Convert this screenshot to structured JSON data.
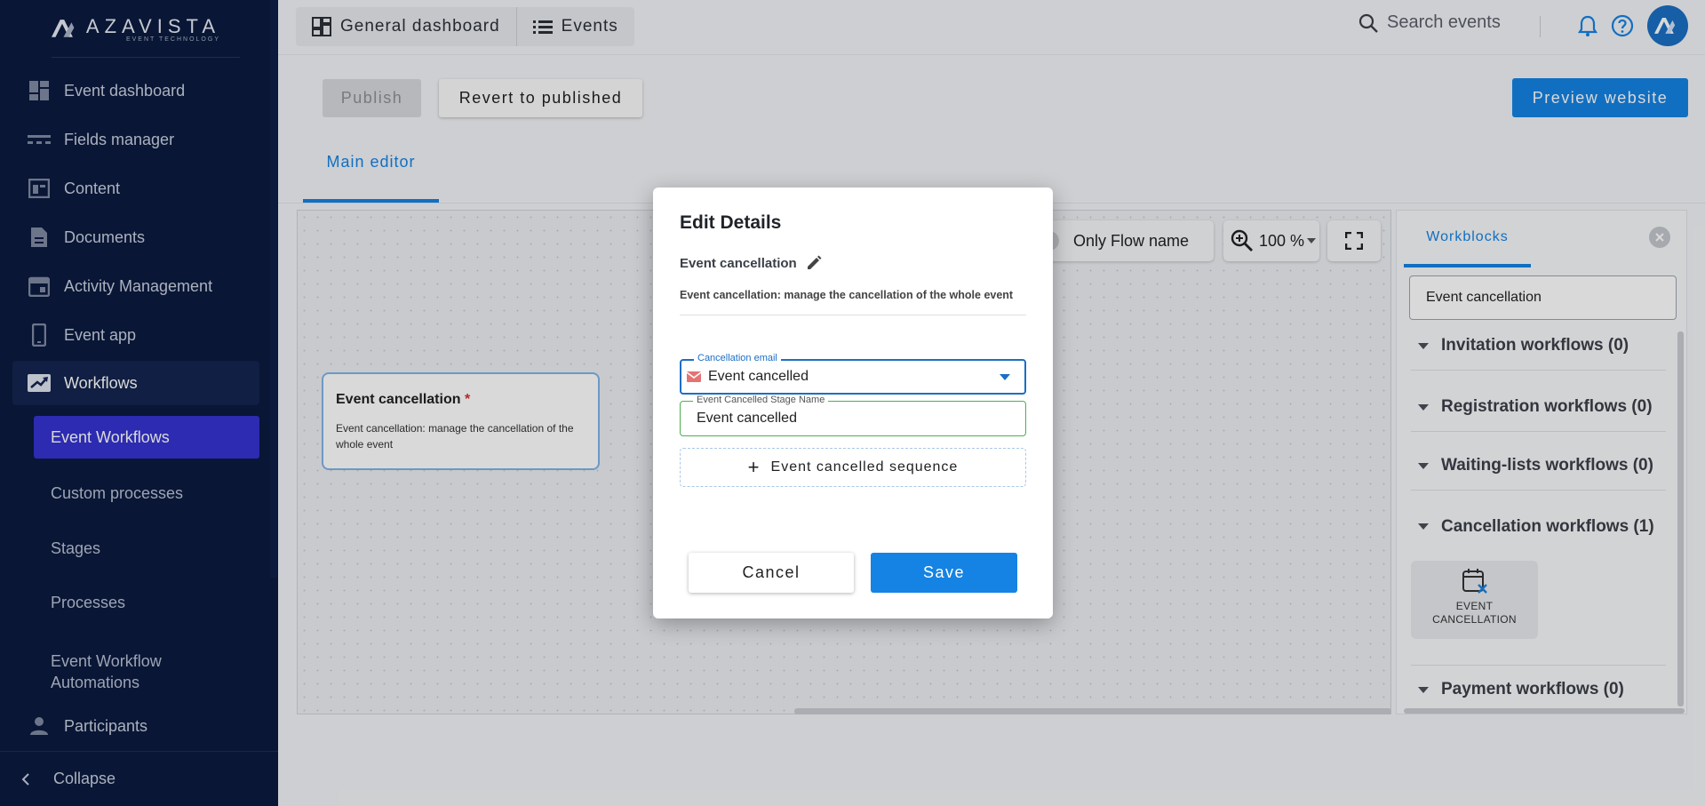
{
  "logo": {
    "name": "AZAVISTA",
    "tagline": "EVENT TECHNOLOGY"
  },
  "sidebar": {
    "items": [
      {
        "label": "Event dashboard",
        "icon": "dashboard-icon"
      },
      {
        "label": "Fields manager",
        "icon": "fields-icon"
      },
      {
        "label": "Content",
        "icon": "content-icon"
      },
      {
        "label": "Documents",
        "icon": "document-icon"
      },
      {
        "label": "Activity Management",
        "icon": "calendar-icon"
      },
      {
        "label": "Event app",
        "icon": "phone-icon"
      },
      {
        "label": "Workflows",
        "icon": "workflow-icon",
        "active": true
      },
      {
        "label": "Participants",
        "icon": "person-icon"
      }
    ],
    "subitems": [
      {
        "label": "Event Workflows",
        "active": true
      },
      {
        "label": "Custom processes"
      },
      {
        "label": "Stages"
      },
      {
        "label": "Processes"
      },
      {
        "label": "Event Workflow Automations"
      }
    ],
    "collapse_label": "Collapse"
  },
  "topbar": {
    "tabs": [
      {
        "label": "General dashboard",
        "icon": "grid-icon"
      },
      {
        "label": "Events",
        "icon": "list-icon"
      }
    ],
    "search_placeholder": "Search events"
  },
  "toolbar": {
    "publish_label": "Publish",
    "revert_label": "Revert to published",
    "preview_label": "Preview website"
  },
  "main_tab": "Main editor",
  "canvas": {
    "node": {
      "title": "Event cancellation",
      "required_mark": "*",
      "description": "Event cancellation: manage the cancellation of the whole event"
    },
    "only_flow_label": "Only Flow name",
    "zoom_label": "100 %"
  },
  "right_panel": {
    "tab_label": "Workblocks",
    "search_value": "Event cancellation",
    "groups": [
      "Invitation workflows (0)",
      "Registration workflows (0)",
      "Waiting-lists workflows (0)",
      "Cancellation workflows (1)",
      "Payment workflows (0)"
    ],
    "card_label": "EVENT CANCELLATION"
  },
  "modal": {
    "title": "Edit Details",
    "subtitle": "Event cancellation",
    "description": "Event cancellation: manage the cancellation of the whole event",
    "select_legend": "Cancellation email",
    "select_value": "Event cancelled",
    "text_legend": "Event Cancelled Stage Name",
    "text_value": "Event cancelled",
    "sequence_label": "Event cancelled sequence",
    "cancel_label": "Cancel",
    "save_label": "Save"
  },
  "colors": {
    "sidebar_bg": "#0b1a3f",
    "accent": "#1583e3",
    "active_sub": "#3433d0"
  }
}
